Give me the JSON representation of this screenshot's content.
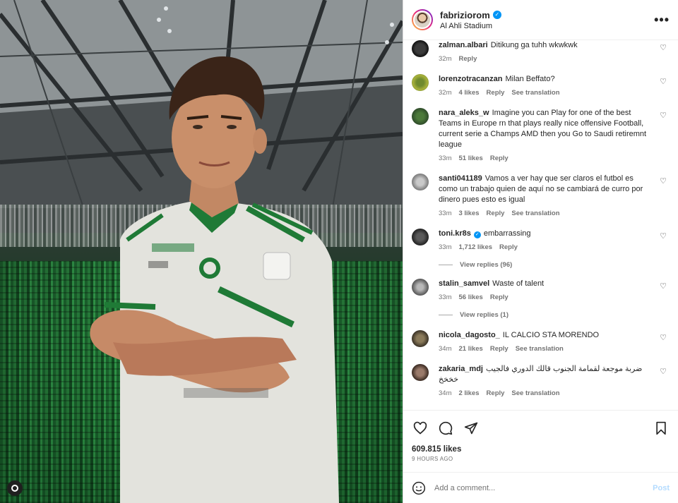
{
  "post": {
    "username": "fabriziorom",
    "location": "Al Ahli Stadium",
    "likes": "609.815 likes",
    "time_ago": "9 HOURS AGO"
  },
  "comments": [
    {
      "user": "zalman.albari",
      "verified": false,
      "text": "Ditikung ga tuhh wkwkwk",
      "time": "32m",
      "likes": "",
      "reply": "Reply",
      "translate": ""
    },
    {
      "user": "lorenzotracanzan",
      "verified": false,
      "text": "Milan Beffato?",
      "time": "32m",
      "likes": "4 likes",
      "reply": "Reply",
      "translate": "See translation"
    },
    {
      "user": "nara_aleks_w",
      "verified": false,
      "text": "Imagine you can Play for one of the best Teams in Europe rn that plays really nice offensive Football, current serie a Champs AMD then you Go to Saudi retiremnt league",
      "time": "33m",
      "likes": "51 likes",
      "reply": "Reply",
      "translate": ""
    },
    {
      "user": "santi041189",
      "verified": false,
      "text": "Vamos a ver hay que ser claros el futbol es como un trabajo quien de aquí no se cambiará de curro por dinero pues esto es igual",
      "time": "33m",
      "likes": "3 likes",
      "reply": "Reply",
      "translate": "See translation"
    },
    {
      "user": "toni.kr8s",
      "verified": true,
      "text": "embarrassing",
      "time": "33m",
      "likes": "1,712 likes",
      "reply": "Reply",
      "translate": "",
      "view_replies": "View replies (96)"
    },
    {
      "user": "stalin_samvel",
      "verified": false,
      "text": "Waste of talent",
      "time": "33m",
      "likes": "56 likes",
      "reply": "Reply",
      "translate": "",
      "view_replies": "View replies (1)"
    },
    {
      "user": "nicola_dagosto_",
      "verified": false,
      "text": "IL CALCIO STA MORENDO",
      "time": "34m",
      "likes": "21 likes",
      "reply": "Reply",
      "translate": "See translation"
    },
    {
      "user": "zakaria_mdj",
      "verified": false,
      "text": "ضربة موجعة لقمامة الجنوب قالك الدوري فالجيب خخخخ",
      "time": "34m",
      "likes": "2 likes",
      "reply": "Reply",
      "translate": "See translation"
    }
  ],
  "add_comment": {
    "placeholder": "Add a comment...",
    "post_label": "Post"
  },
  "icons": {
    "heart": "heart-icon",
    "comment": "comment-icon",
    "share": "share-icon",
    "save": "bookmark-icon",
    "more": "more-options-icon",
    "emoji": "emoji-icon"
  },
  "colors": {
    "verified": "#0095f6",
    "post_disabled": "#b3dbff",
    "muted": "#737373"
  }
}
